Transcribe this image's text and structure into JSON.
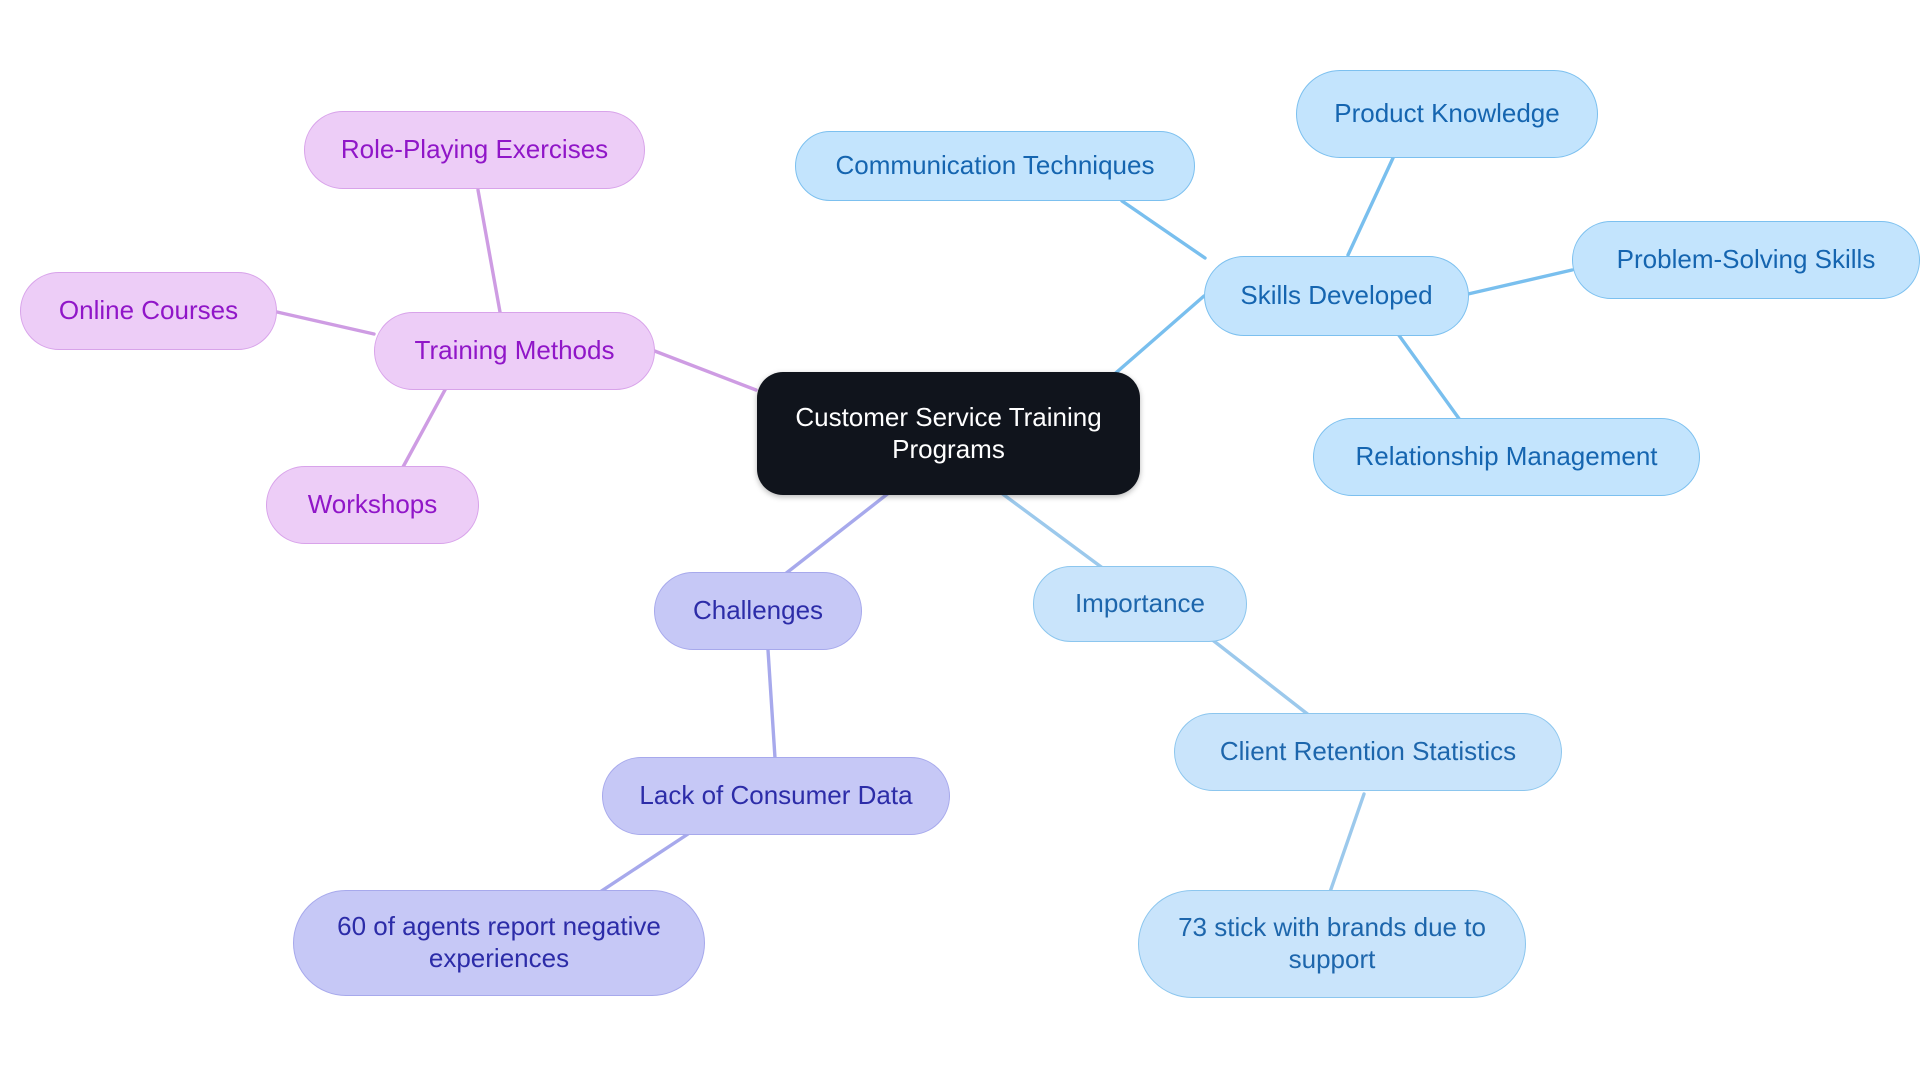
{
  "diagram": {
    "type": "mindmap",
    "title": "Customer Service Training Programs",
    "background_color": "#ffffff",
    "root": {
      "label": "Customer Service Training\nPrograms",
      "fill": "#10141c",
      "text_color": "#ffffff"
    },
    "branches": [
      {
        "id": "skills-developed",
        "label": "Skills Developed",
        "fill": "#c3e4fd",
        "stroke": "#7cc0ef",
        "text_color": "#1565b0",
        "children": [
          {
            "id": "communication-techniques",
            "label": "Communication Techniques"
          },
          {
            "id": "product-knowledge",
            "label": "Product Knowledge"
          },
          {
            "id": "problem-solving-skills",
            "label": "Problem-Solving Skills"
          },
          {
            "id": "relationship-management",
            "label": "Relationship Management"
          }
        ]
      },
      {
        "id": "training-methods",
        "label": "Training Methods",
        "fill": "#edcdf7",
        "stroke": "#d8a3ea",
        "text_color": "#9016c8",
        "children": [
          {
            "id": "role-playing-exercises",
            "label": "Role-Playing Exercises"
          },
          {
            "id": "online-courses",
            "label": "Online Courses"
          },
          {
            "id": "workshops",
            "label": "Workshops"
          }
        ]
      },
      {
        "id": "challenges",
        "label": "Challenges",
        "fill": "#c6c8f6",
        "stroke": "#a7a9ec",
        "text_color": "#2c2ca8",
        "children": [
          {
            "id": "lack-of-consumer-data",
            "label": "Lack of Consumer Data"
          },
          {
            "id": "agents-negative-experiences",
            "label": "60 of agents report negative\nexperiences"
          }
        ]
      },
      {
        "id": "importance",
        "label": "Importance",
        "fill": "#c9e4fb",
        "stroke": "#8cc6ee",
        "text_color": "#1d66ac",
        "children": [
          {
            "id": "client-retention-statistics",
            "label": "Client Retention Statistics"
          },
          {
            "id": "stick-with-brands-support",
            "label": "73 stick with brands due to\nsupport"
          }
        ]
      }
    ],
    "edge_colors": {
      "blue": "#79bfee",
      "purple": "#ce9ce3",
      "indigo": "#a7a9ec",
      "blue_light": "#9cc9ec"
    }
  }
}
